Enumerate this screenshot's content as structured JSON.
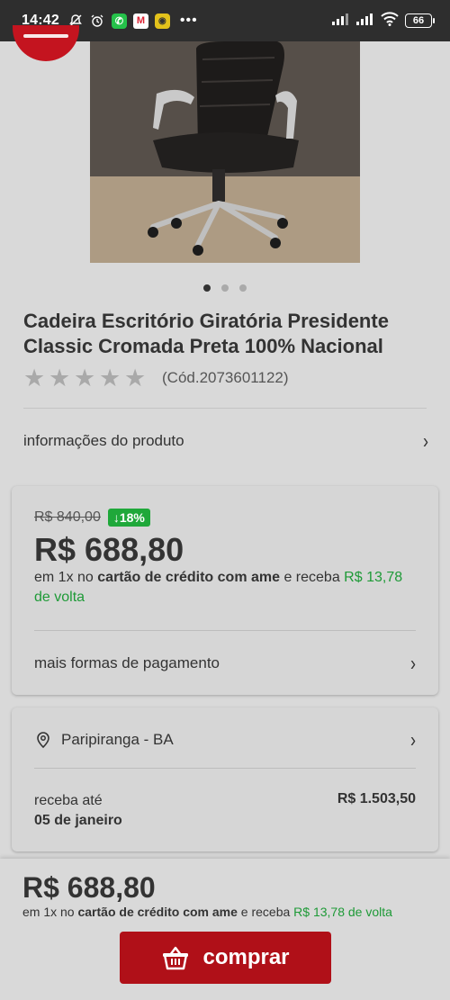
{
  "status_bar": {
    "time": "14:42",
    "battery": "66"
  },
  "product": {
    "title": "Cadeira Escritório Giratória Presidente Classic Cromada Preta 100% Nacional",
    "sku": "(Cód.2073601122)",
    "rating_stars": 0,
    "rating_max": 5,
    "images_count": 3,
    "active_image": 1
  },
  "info_row": {
    "label": "informações do produto"
  },
  "price_card": {
    "old_price": "R$ 840,00",
    "discount": "18%",
    "price": "R$ 688,80",
    "pay_prefix": "em 1x no ",
    "pay_method": "cartão de crédito com ame",
    "pay_middle": " e receba ",
    "cashback": "R$ 13,78 de volta",
    "more_payment": "mais formas de pagamento"
  },
  "shipping_card": {
    "location": "Paripiranga - BA",
    "receive_label": "receba até",
    "receive_date": "05 de janeiro",
    "shipping_price": "R$ 1.503,50"
  },
  "bottom_bar": {
    "price": "R$ 688,80",
    "pay_prefix": "em 1x no ",
    "pay_method": "cartão de crédito com ame",
    "pay_middle": " e receba ",
    "cashback": "R$ 13,78 de volta",
    "buy_label": "comprar"
  },
  "colors": {
    "brand_red": "#b01018",
    "cashback_green": "#1e9a37",
    "discount_green": "#1fa83a"
  }
}
